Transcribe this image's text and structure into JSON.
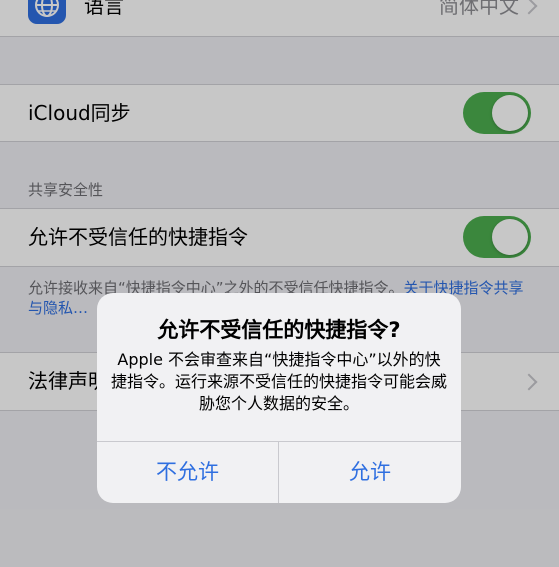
{
  "settings": {
    "language": {
      "label": "语言",
      "value": "简体中文",
      "icon": "globe-icon"
    },
    "icloud_sync": {
      "label": "iCloud同步",
      "enabled": true
    },
    "sharing_security": {
      "header": "共享安全性",
      "allow_untrusted": {
        "label": "允许不受信任的快捷指令",
        "enabled": true
      },
      "footer_text": "允许接收来自“快捷指令中心”之外的不受信任快捷指令。",
      "footer_link": "关于快捷指令共享与隐私…"
    },
    "legal": {
      "label": "法律声明"
    }
  },
  "alert": {
    "title": "允许不受信任的快捷指令?",
    "message": "Apple 不会审查来自“快捷指令中心”以外的快捷指令。运行来源不受信任的快捷指令可能会威胁您个人数据的安全。",
    "deny_label": "不允许",
    "allow_label": "允许"
  },
  "colors": {
    "accent": "#2f6fe0",
    "toggle_on": "#4cae4f",
    "background": "#efeff4"
  }
}
